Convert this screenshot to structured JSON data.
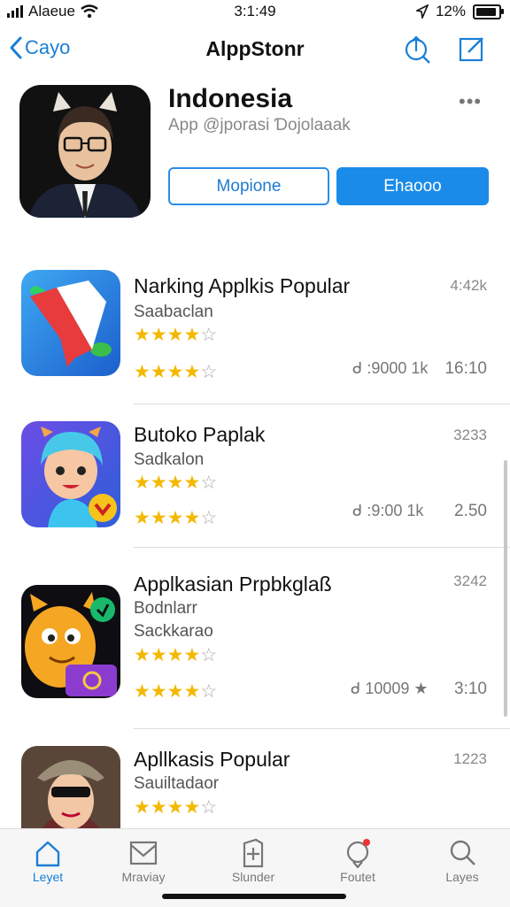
{
  "status": {
    "carrier": "Alaeue",
    "time": "3:1:49",
    "battery": "12%"
  },
  "nav": {
    "back_label": "Cayo",
    "title": "AlppStonr"
  },
  "hero": {
    "title": "Indonesia",
    "subtitle": "App @jporasi Ɗojolaaak",
    "more": "•••",
    "button_outline": "Mopione",
    "button_fill": "Ehaooo"
  },
  "apps": [
    {
      "name": "Narking Applkis Popular",
      "code": "4:42k",
      "sub": "Saabaclan",
      "sub2": "",
      "meta": "ᑯ :9000 1k",
      "time": "16:10",
      "rating1": 4,
      "rating2": 4
    },
    {
      "name": "Butoko Paplak",
      "code": "3233",
      "sub": "Sadkalon",
      "sub2": "",
      "meta": "ᑯ :9:00 1k",
      "time": "2.50",
      "rating1": 4,
      "rating2": 4
    },
    {
      "name": "Applkasian Prpbkglaß",
      "code": "3242",
      "sub": "Bodnlarr",
      "sub2": "Sackkarao",
      "meta": "ᑯ 10009 ★",
      "time": "3:10",
      "rating1": 4,
      "rating2": 4
    },
    {
      "name": "Apllkasis Popular",
      "code": "1223",
      "sub": "Sauiltadaor",
      "sub2": "",
      "meta": "",
      "time": "",
      "rating1": 4,
      "rating2": 0
    }
  ],
  "tabs": [
    {
      "label": "Leyet",
      "icon": "home-icon"
    },
    {
      "label": "Mraviay",
      "icon": "mail-icon"
    },
    {
      "label": "Slunder",
      "icon": "plus-square-icon"
    },
    {
      "label": "Foutet",
      "icon": "bell-icon"
    },
    {
      "label": "Layes",
      "icon": "search-icon"
    }
  ],
  "colors": {
    "accent": "#1a8be9",
    "star": "#f3b800"
  }
}
